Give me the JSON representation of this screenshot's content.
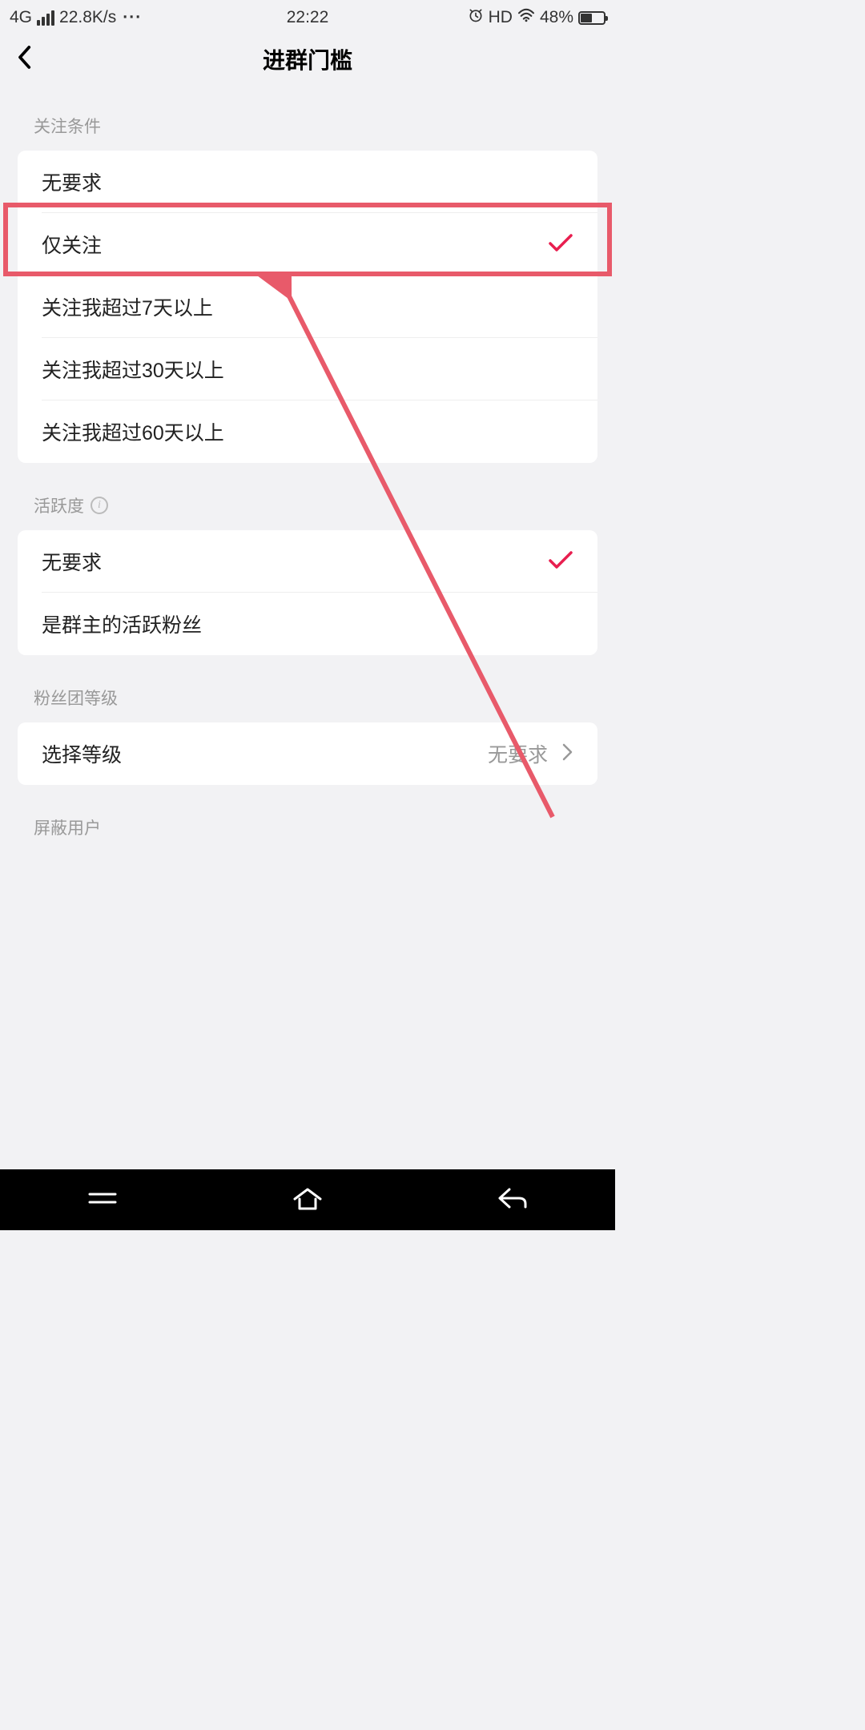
{
  "status": {
    "network": "4G",
    "speed": "22.8K/s",
    "dots": "···",
    "time": "22:22",
    "hd": "HD",
    "battery_pct": "48%"
  },
  "header": {
    "title": "进群门槛"
  },
  "sections": {
    "follow": {
      "title": "关注条件",
      "options": [
        {
          "label": "无要求",
          "selected": false
        },
        {
          "label": "仅关注",
          "selected": true
        },
        {
          "label": "关注我超过7天以上",
          "selected": false
        },
        {
          "label": "关注我超过30天以上",
          "selected": false
        },
        {
          "label": "关注我超过60天以上",
          "selected": false
        }
      ]
    },
    "activity": {
      "title": "活跃度",
      "options": [
        {
          "label": "无要求",
          "selected": true
        },
        {
          "label": "是群主的活跃粉丝",
          "selected": false
        }
      ]
    },
    "fanclub": {
      "title": "粉丝团等级",
      "row_label": "选择等级",
      "row_value": "无要求"
    },
    "block": {
      "title": "屏蔽用户"
    }
  }
}
